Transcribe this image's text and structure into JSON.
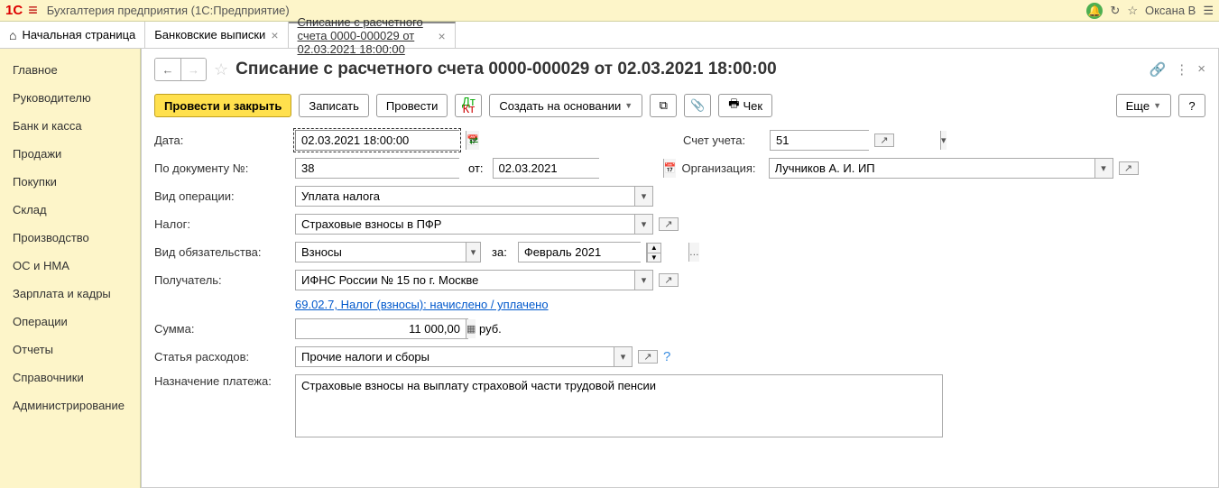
{
  "app": {
    "title": "Бухгалтерия предприятия  (1С:Предприятие)",
    "user": "Оксана В"
  },
  "tabs": {
    "home": "Начальная страница",
    "t1": "Банковские выписки",
    "t2": "Списание с расчетного счета 0000-000029 от 02.03.2021 18:00:00"
  },
  "sidebar": {
    "i0": "Главное",
    "i1": "Руководителю",
    "i2": "Банк и касса",
    "i3": "Продажи",
    "i4": "Покупки",
    "i5": "Склад",
    "i6": "Производство",
    "i7": "ОС и НМА",
    "i8": "Зарплата и кадры",
    "i9": "Операции",
    "i10": "Отчеты",
    "i11": "Справочники",
    "i12": "Администрирование"
  },
  "doc": {
    "title": "Списание с расчетного счета 0000-000029 от 02.03.2021 18:00:00"
  },
  "toolbar": {
    "post_close": "Провести и закрыть",
    "save": "Записать",
    "post": "Провести",
    "create_based": "Создать на основании",
    "check": "Чек",
    "more": "Еще",
    "help": "?"
  },
  "form": {
    "date_label": "Дата:",
    "date_value": "02.03.2021 18:00:00",
    "docnum_label": "По документу №:",
    "docnum_value": "38",
    "from_label": "от:",
    "from_date": "02.03.2021",
    "account_label": "Счет учета:",
    "account_value": "51",
    "org_label": "Организация:",
    "org_value": "Лучников А. И. ИП",
    "optype_label": "Вид операции:",
    "optype_value": "Уплата налога",
    "tax_label": "Налог:",
    "tax_value": "Страховые взносы в ПФР",
    "obligation_label": "Вид обязательства:",
    "obligation_value": "Взносы",
    "period_label": "за:",
    "period_value": "Февраль 2021",
    "recipient_label": "Получатель:",
    "recipient_value": "ИФНС России № 15 по г. Москве",
    "link": "69.02.7, Налог (взносы): начислено / уплачено",
    "amount_label": "Сумма:",
    "amount_value": "11 000,00",
    "currency": "руб.",
    "expense_label": "Статья расходов:",
    "expense_value": "Прочие налоги и сборы",
    "purpose_label": "Назначение платежа:",
    "purpose_value": "Страховые взносы на выплату страховой части трудовой пенсии"
  }
}
